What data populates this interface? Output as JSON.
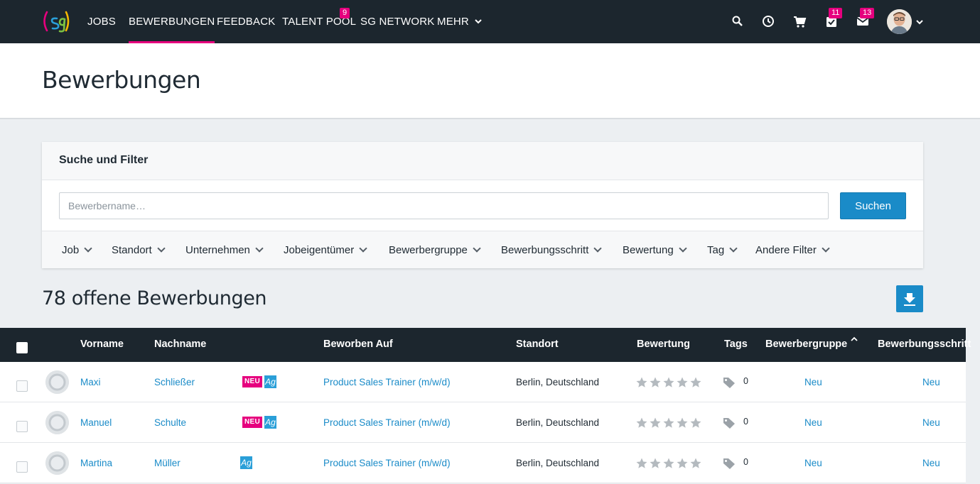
{
  "nav": {
    "items": [
      {
        "label": "JOBS"
      },
      {
        "label": "BEWERBUNGEN"
      },
      {
        "label": "FEEDBACK"
      },
      {
        "label": "TALENT POOL",
        "badge": "9"
      },
      {
        "label": "SG NETWORK"
      },
      {
        "label": "MEHR"
      }
    ],
    "tasks_badge": "11",
    "mail_badge": "13",
    "accent_color": "#e6007e",
    "bg_color": "#1c262e"
  },
  "header": {
    "title": "Bewerbungen"
  },
  "filter_card": {
    "title": "Suche und Filter",
    "search_placeholder": "Bewerbername…",
    "search_button": "Suchen",
    "filters": [
      "Job",
      "Standort",
      "Unternehmen",
      "Jobeigentümer",
      "Bewerbergruppe",
      "Bewerbungsschritt",
      "Bewertung",
      "Tag",
      "Andere Filter"
    ]
  },
  "results": {
    "title": "78 offene Bewerbungen"
  },
  "table": {
    "columns": [
      "Vorname",
      "Nachname",
      "Beworben Auf",
      "Standort",
      "Bewertung",
      "Tags",
      "Bewerbergruppe",
      "Bewerbungsschritt"
    ],
    "rows": [
      {
        "vorname": "Maxi",
        "nachname": "Schließer",
        "neu": "NEU",
        "ag": "Ag",
        "job": "Product Sales Trainer (m/w/d)",
        "standort": "Berlin, Deutschland",
        "rating": 0,
        "tags": "0",
        "gruppe": "Neu",
        "schritt": "Neu"
      },
      {
        "vorname": "Manuel",
        "nachname": "Schulte",
        "neu": "NEU",
        "ag": "Ag",
        "job": "Product Sales Trainer (m/w/d)",
        "standort": "Berlin, Deutschland",
        "rating": 0,
        "tags": "0",
        "gruppe": "Neu",
        "schritt": "Neu"
      },
      {
        "vorname": "Martina",
        "nachname": "Müller",
        "ag": "Ag",
        "job": "Product Sales Trainer (m/w/d)",
        "standort": "Berlin, Deutschland",
        "rating": 0,
        "tags": "0",
        "gruppe": "Neu",
        "schritt": "Neu"
      }
    ]
  }
}
